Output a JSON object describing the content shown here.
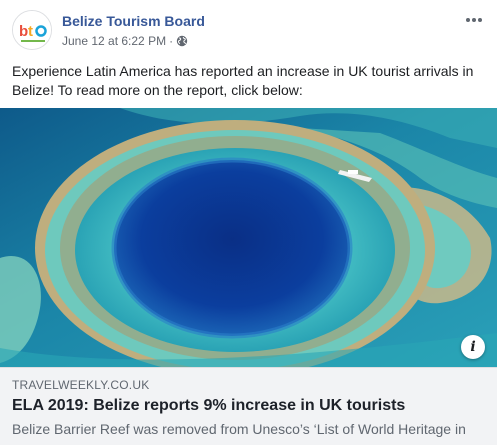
{
  "post": {
    "page_name": "Belize Tourism Board",
    "timestamp": "June 12 at 6:22 PM",
    "separator": "·",
    "audience_icon": "globe-icon",
    "more_icon": "more-options-icon",
    "avatar_logo_text": "bt",
    "message": "Experience Latin America has reported an increase in UK tourist arrivals in Belize! To read more on the report, click below:"
  },
  "link": {
    "domain": "TRAVELWEEKLY.CO.UK",
    "headline": "ELA 2019: Belize reports 9% increase in UK tourists",
    "description": "Belize Barrier Reef was removed from Unesco’s ‘List of World Heritage in",
    "info_icon": "info-icon",
    "info_glyph": "i",
    "image": "aerial-great-blue-hole-photo"
  },
  "colors": {
    "page_name": "#385898",
    "meta": "#616770",
    "caption_bg": "#f2f3f5"
  }
}
